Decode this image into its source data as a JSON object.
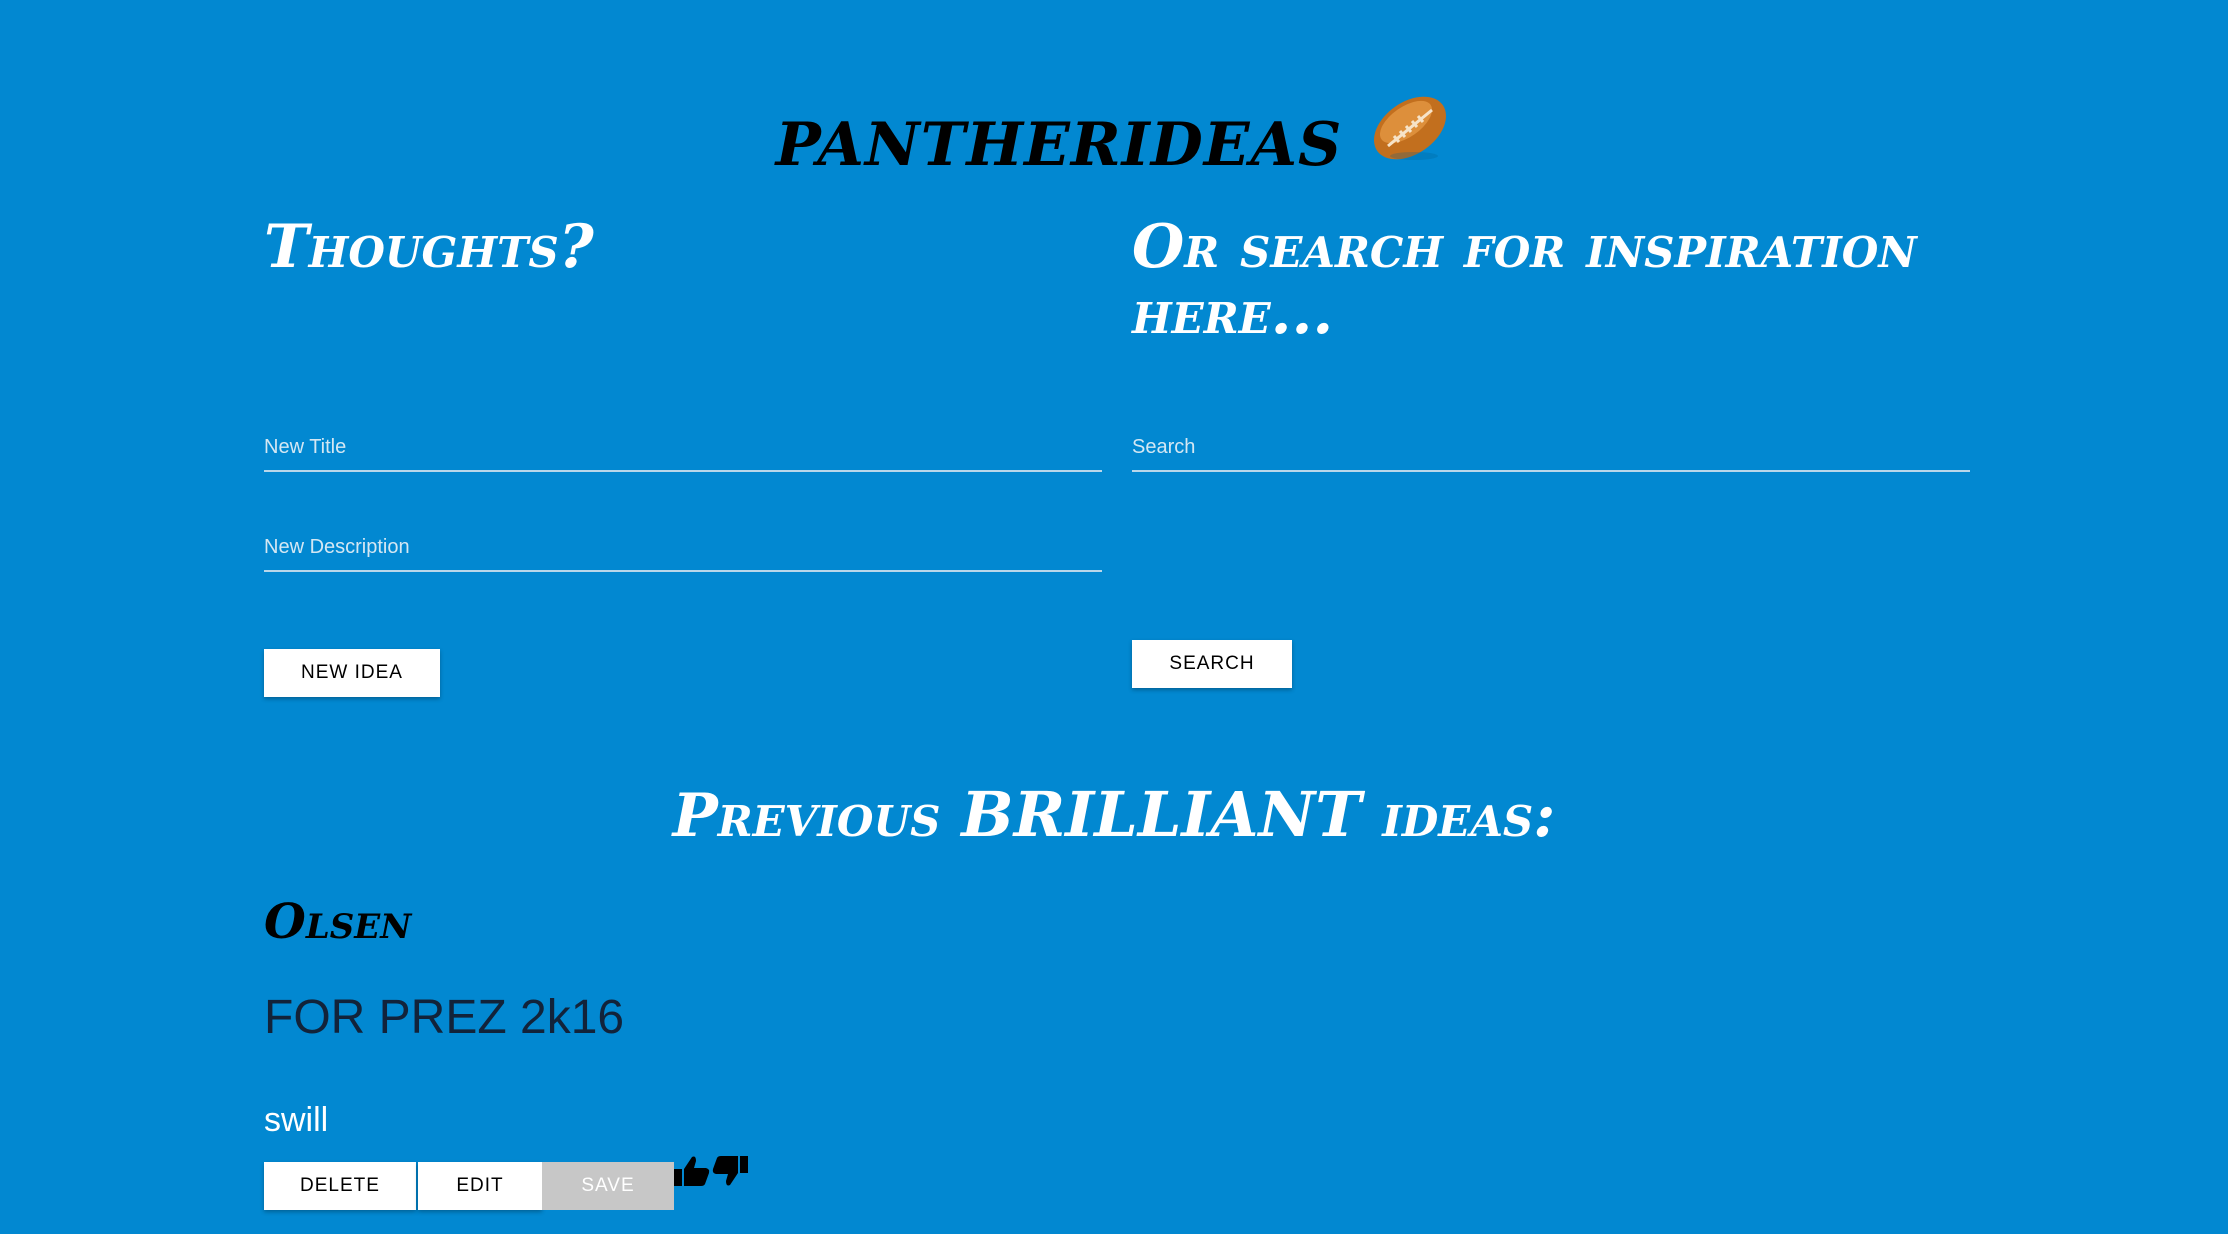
{
  "app": {
    "title": "pantherIDEAS",
    "title_icon": "football-icon"
  },
  "create": {
    "heading": "Thoughts?",
    "title_placeholder": "New Title",
    "title_value": "",
    "description_placeholder": "New Description",
    "description_value": "",
    "submit_label": "NEW IDEA"
  },
  "search": {
    "heading": "Or search for inspiration here...",
    "placeholder": "Search",
    "value": "",
    "button_label": "SEARCH"
  },
  "previous": {
    "heading_lead": "Previous",
    "heading_emphasis": "BRILLIANT",
    "heading_tail": "ideas:"
  },
  "ideas": [
    {
      "title": "Olsen",
      "body": "FOR PREZ 2k16",
      "quality": "swill",
      "delete_label": "DELETE",
      "edit_label": "EDIT",
      "save_label": "SAVE",
      "upvote_icon": "thumbs-up-icon",
      "downvote_icon": "thumbs-down-icon"
    }
  ],
  "colors": {
    "background": "#0288d1",
    "heading_text": "#ffffff",
    "title_text": "#000000",
    "button_bg": "#ffffff",
    "save_button_bg": "#c7c7c7"
  }
}
